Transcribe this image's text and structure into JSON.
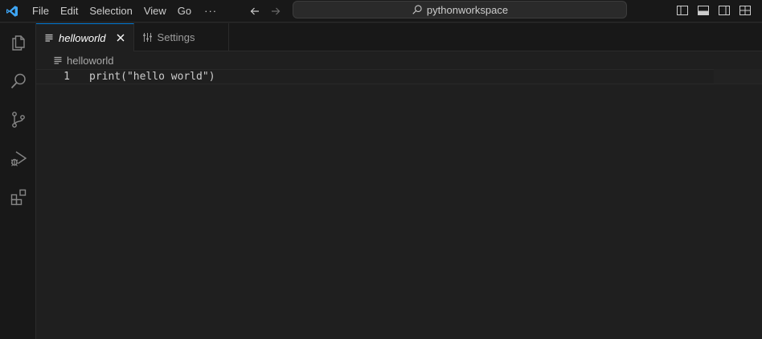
{
  "window": {
    "search_text": "pythonworkspace"
  },
  "menu": {
    "items": [
      "File",
      "Edit",
      "Selection",
      "View",
      "Go"
    ],
    "more": "···"
  },
  "icons": {
    "app": "vscode-logo-icon",
    "back": "arrow-left-icon",
    "forward": "arrow-right-icon",
    "search": "search-icon",
    "toggle_primary_sidebar": "sidebar-left-icon",
    "toggle_panel": "panel-bottom-icon",
    "toggle_secondary_sidebar": "sidebar-right-icon",
    "customize_layout": "layout-icon",
    "explorer": "files-icon",
    "search_view": "search-icon",
    "source_control": "source-control-icon",
    "run_debug": "run-debug-icon",
    "extensions": "extensions-icon",
    "file": "text-file-icon",
    "settings": "settings-sliders-icon",
    "close": "close-icon"
  },
  "colors": {
    "accent": "#0078d4",
    "logo": "#3ea6f6"
  },
  "tabs": [
    {
      "label": "helloworld",
      "active": true
    },
    {
      "label": "Settings",
      "active": false
    }
  ],
  "breadcrumb": {
    "file": "helloworld"
  },
  "editor": {
    "lines": [
      {
        "number": "1",
        "code": "print(\"hello world\")"
      }
    ]
  }
}
